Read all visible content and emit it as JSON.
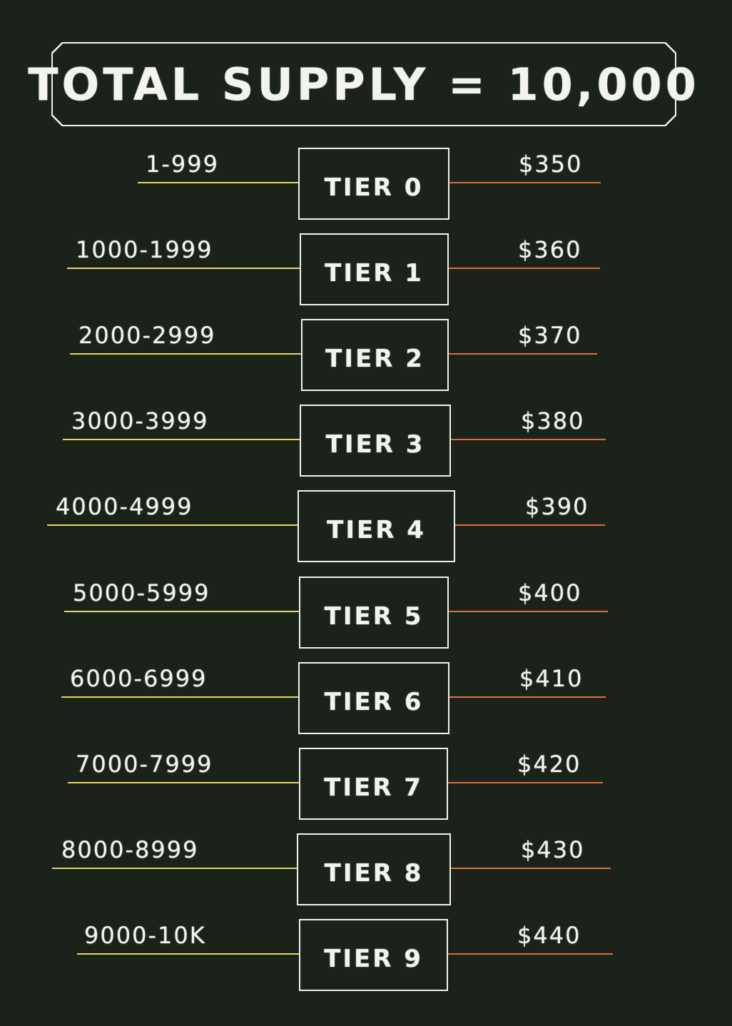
{
  "header": {
    "title": "TOTAL SUPPLY = 10,000"
  },
  "colors": {
    "background": "#1a2219",
    "chalk": "#f1f1ee",
    "range_line": "#e6d56a",
    "price_line": "#e06b3c"
  },
  "tiers": [
    {
      "range": "1-999",
      "label": "TIER 0",
      "price": "$350"
    },
    {
      "range": "1000-1999",
      "label": "TIER 1",
      "price": "$360"
    },
    {
      "range": "2000-2999",
      "label": "TIER 2",
      "price": "$370"
    },
    {
      "range": "3000-3999",
      "label": "TIER 3",
      "price": "$380"
    },
    {
      "range": "4000-4999",
      "label": "TIER 4",
      "price": "$390"
    },
    {
      "range": "5000-5999",
      "label": "TIER 5",
      "price": "$400"
    },
    {
      "range": "6000-6999",
      "label": "TIER 6",
      "price": "$410"
    },
    {
      "range": "7000-7999",
      "label": "TIER 7",
      "price": "$420"
    },
    {
      "range": "8000-8999",
      "label": "TIER 8",
      "price": "$430"
    },
    {
      "range": "9000-10K",
      "label": "TIER 9",
      "price": "$440"
    }
  ]
}
